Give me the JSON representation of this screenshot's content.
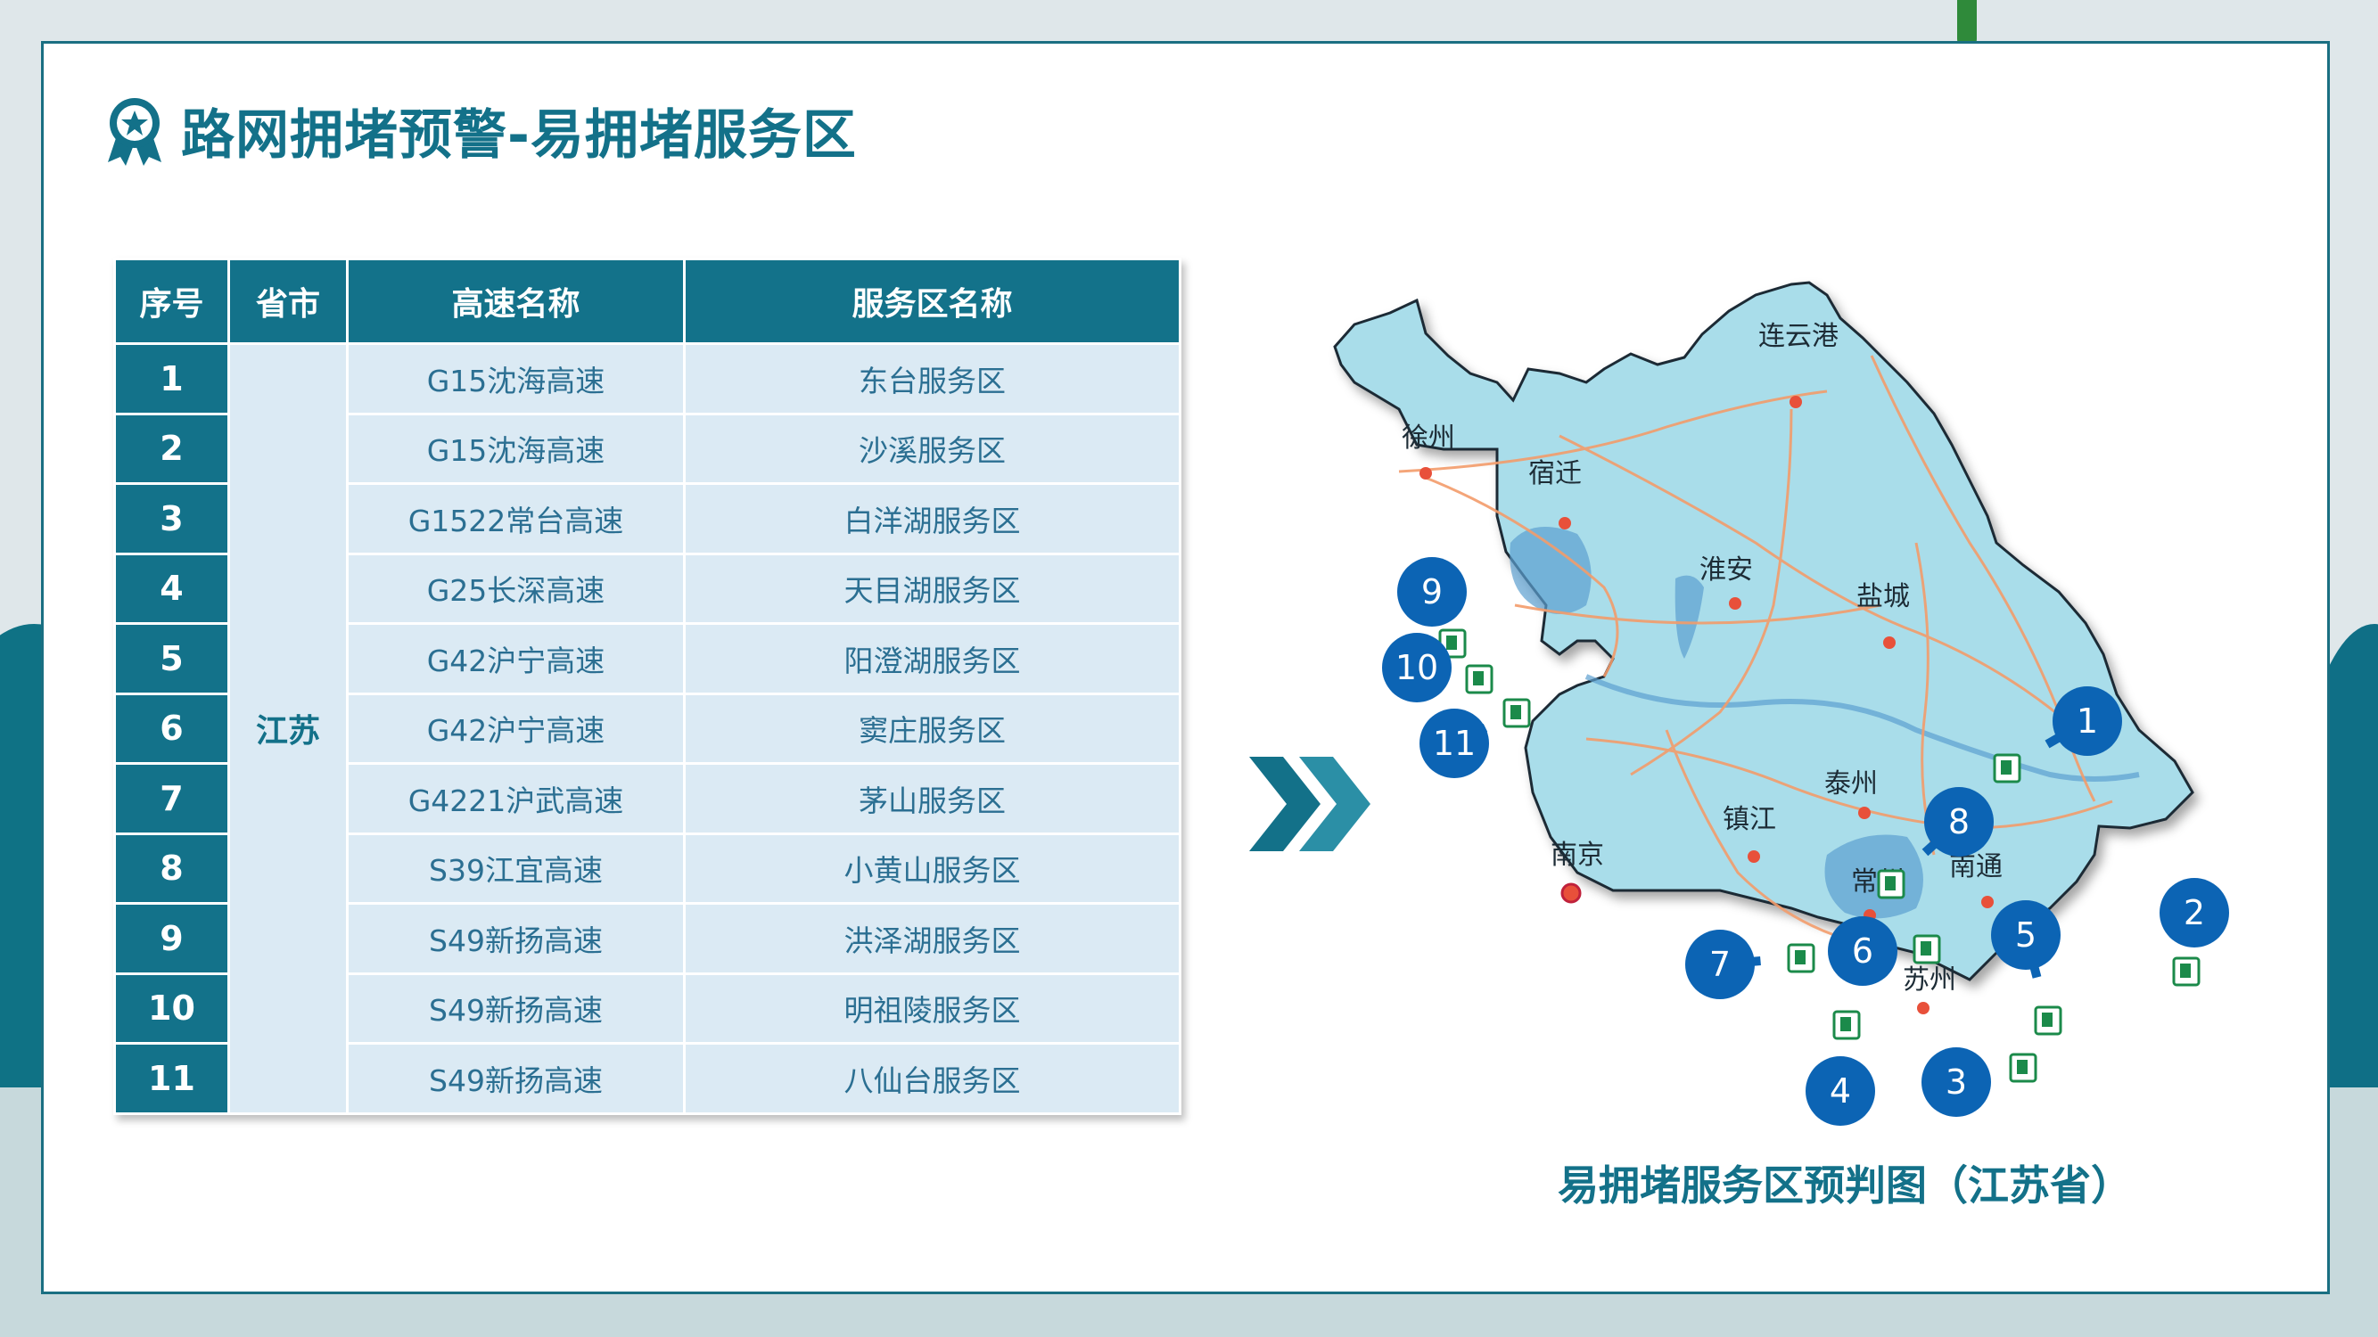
{
  "page": {
    "title": "路网拥堵预警-易拥堵服务区"
  },
  "table": {
    "headers": [
      "序号",
      "省市",
      "高速名称",
      "服务区名称"
    ],
    "province": "江苏",
    "rows": [
      {
        "no": "1",
        "highway": "G15沈海高速",
        "area": "东台服务区"
      },
      {
        "no": "2",
        "highway": "G15沈海高速",
        "area": "沙溪服务区"
      },
      {
        "no": "3",
        "highway": "G1522常台高速",
        "area": "白洋湖服务区"
      },
      {
        "no": "4",
        "highway": "G25长深高速",
        "area": "天目湖服务区"
      },
      {
        "no": "5",
        "highway": "G42沪宁高速",
        "area": "阳澄湖服务区"
      },
      {
        "no": "6",
        "highway": "G42沪宁高速",
        "area": "窦庄服务区"
      },
      {
        "no": "7",
        "highway": "G4221沪武高速",
        "area": "茅山服务区"
      },
      {
        "no": "8",
        "highway": "S39江宜高速",
        "area": "小黄山服务区"
      },
      {
        "no": "9",
        "highway": "S49新扬高速",
        "area": "洪泽湖服务区"
      },
      {
        "no": "10",
        "highway": "S49新扬高速",
        "area": "明祖陵服务区"
      },
      {
        "no": "11",
        "highway": "S49新扬高速",
        "area": "八仙台服务区"
      }
    ]
  },
  "map": {
    "caption": "易拥堵服务区预判图（江苏省）",
    "cities": [
      "连云港",
      "徐州",
      "宿迁",
      "淮安",
      "盐城",
      "泰州",
      "镇江",
      "南京",
      "南通",
      "常州",
      "苏州"
    ],
    "markers": [
      "1",
      "2",
      "3",
      "4",
      "5",
      "6",
      "7",
      "8",
      "9",
      "10",
      "11"
    ]
  },
  "colors": {
    "brand": "#137189",
    "table_cell": "#dbeaf4",
    "map_fill": "#a9ddea",
    "marker": "#0c64b4"
  },
  "icons": {
    "badge": "ribbon-badge-icon",
    "arrow": "double-chevron-right-icon",
    "service_area": "fuel-pump-icon"
  }
}
